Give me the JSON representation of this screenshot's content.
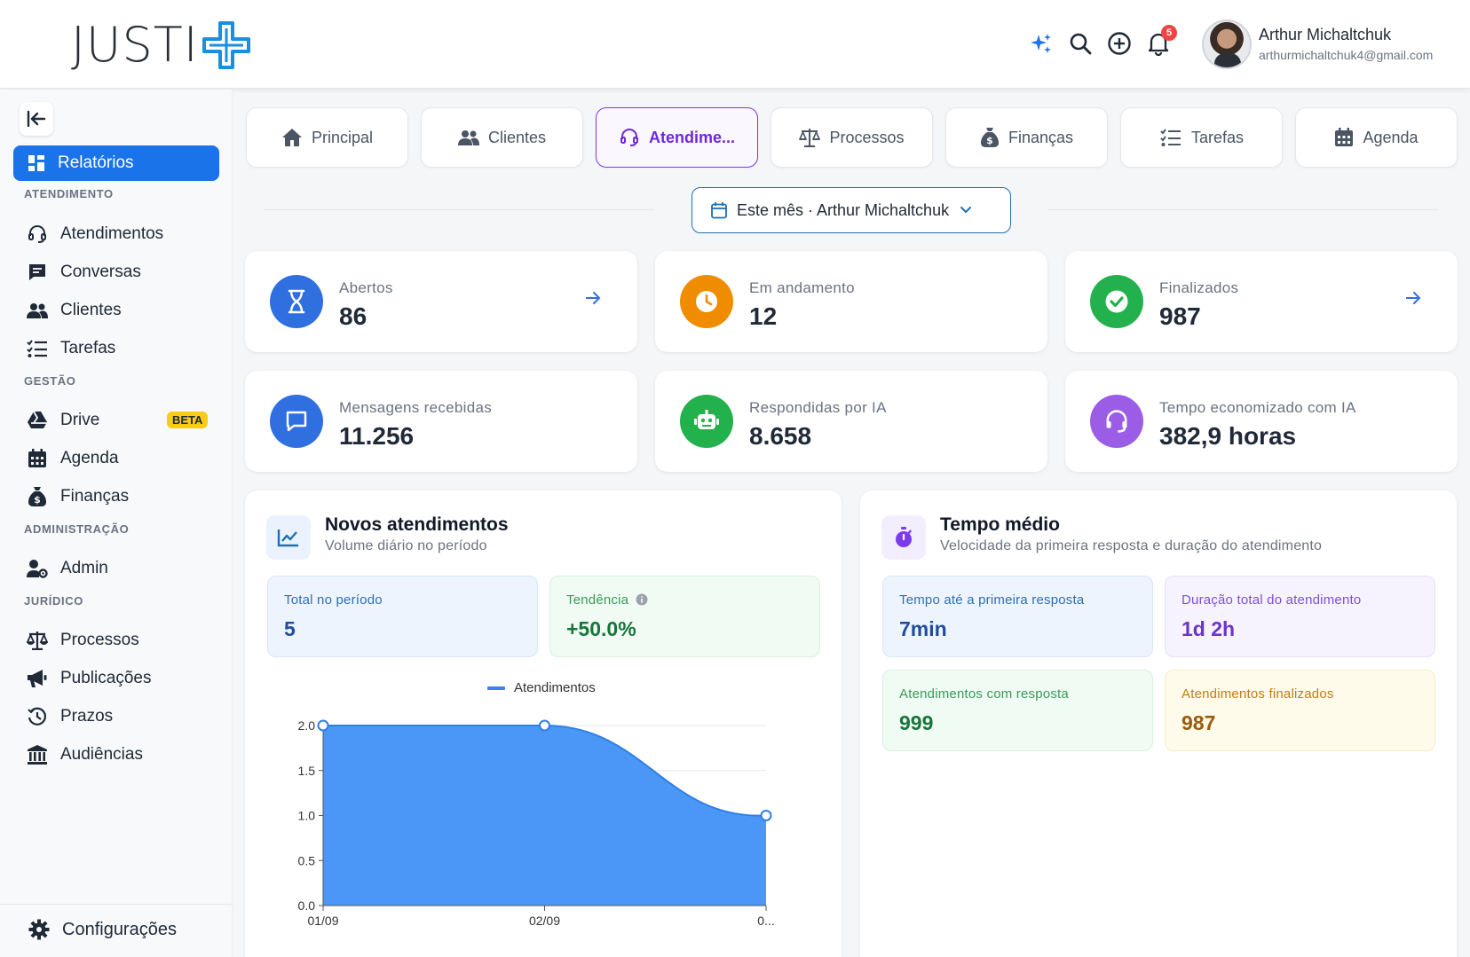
{
  "header": {
    "logo_text": "JUSTI",
    "user": {
      "name": "Arthur Michaltchuk",
      "email": "arthurmichaltchuk4@gmail.com"
    },
    "notifications_count": "5",
    "icons": [
      "sparkles-icon",
      "search-icon",
      "plus-circle-icon",
      "bell-icon"
    ]
  },
  "sidebar": {
    "active": {
      "label": "Relatórios",
      "icon": "grid-icon"
    },
    "sections": [
      {
        "label": "ATENDIMENTO",
        "items": [
          {
            "label": "Atendimentos",
            "icon": "headset-icon"
          },
          {
            "label": "Conversas",
            "icon": "chat-icon"
          },
          {
            "label": "Clientes",
            "icon": "users-icon"
          },
          {
            "label": "Tarefas",
            "icon": "list-check-icon"
          }
        ]
      },
      {
        "label": "GESTÃO",
        "items": [
          {
            "label": "Drive",
            "icon": "drive-icon",
            "badge": "BETA"
          },
          {
            "label": "Agenda",
            "icon": "calendar-icon"
          },
          {
            "label": "Finanças",
            "icon": "money-bag-icon"
          }
        ]
      },
      {
        "label": "ADMINISTRAÇÃO",
        "items": [
          {
            "label": "Admin",
            "icon": "user-gear-icon"
          }
        ]
      },
      {
        "label": "JURÍDICO",
        "items": [
          {
            "label": "Processos",
            "icon": "scale-icon"
          },
          {
            "label": "Publicações",
            "icon": "megaphone-icon"
          },
          {
            "label": "Prazos",
            "icon": "clock-rotate-icon"
          },
          {
            "label": "Audiências",
            "icon": "courthouse-icon"
          }
        ]
      }
    ],
    "footer": {
      "label": "Configurações",
      "icon": "gear-icon"
    }
  },
  "tabs": [
    {
      "label": "Principal",
      "icon": "home-icon"
    },
    {
      "label": "Clientes",
      "icon": "users-icon"
    },
    {
      "label": "Atendime...",
      "icon": "headset-icon",
      "active": true
    },
    {
      "label": "Processos",
      "icon": "scale-icon"
    },
    {
      "label": "Finanças",
      "icon": "money-bag-icon"
    },
    {
      "label": "Tarefas",
      "icon": "list-check-icon"
    },
    {
      "label": "Agenda",
      "icon": "calendar-icon"
    }
  ],
  "filter": {
    "label": "Este mês · Arthur Michaltchuk"
  },
  "stats": [
    {
      "label": "Abertos",
      "value": "86",
      "color": "#2f6fe0",
      "icon": "hourglass-icon",
      "arrow": true
    },
    {
      "label": "Em andamento",
      "value": "12",
      "color": "#f08c00",
      "icon": "clock-icon",
      "arrow": false
    },
    {
      "label": "Finalizados",
      "value": "987",
      "color": "#22b14c",
      "icon": "check-circle-icon",
      "arrow": true
    },
    {
      "label": "Mensagens recebidas",
      "value": "11.256",
      "color": "#2f6fe0",
      "icon": "message-icon",
      "arrow": false
    },
    {
      "label": "Respondidas por IA",
      "value": "8.658",
      "color": "#22b14c",
      "icon": "robot-icon",
      "arrow": false
    },
    {
      "label": "Tempo economizado com IA",
      "value": "382,9 horas",
      "color": "#9b5de5",
      "icon": "headset-icon",
      "arrow": false
    }
  ],
  "novos": {
    "title": "Novos atendimentos",
    "subtitle": "Volume diário no período",
    "total_label": "Total no período",
    "total_value": "5",
    "trend_label": "Tendência",
    "trend_value": "+50.0%"
  },
  "tempo": {
    "title": "Tempo médio",
    "subtitle": "Velocidade da primeira resposta e duração do atendimento",
    "cards": [
      {
        "label": "Tempo até a primeira resposta",
        "value": "7min"
      },
      {
        "label": "Duração total do atendimento",
        "value": "1d 2h"
      },
      {
        "label": "Atendimentos com resposta",
        "value": "999"
      },
      {
        "label": "Atendimentos finalizados",
        "value": "987"
      }
    ]
  },
  "chart_data": {
    "type": "area",
    "categories": [
      "01/09",
      "02/09",
      "0..."
    ],
    "series": [
      {
        "name": "Atendimentos",
        "values": [
          2,
          2,
          1
        ],
        "color": "#3b82f6"
      }
    ],
    "ylim": [
      0,
      2
    ],
    "yticks": [
      "0.0",
      "0.5",
      "1.0",
      "1.5",
      "2.0"
    ],
    "legend": "top-center",
    "grid": true
  }
}
